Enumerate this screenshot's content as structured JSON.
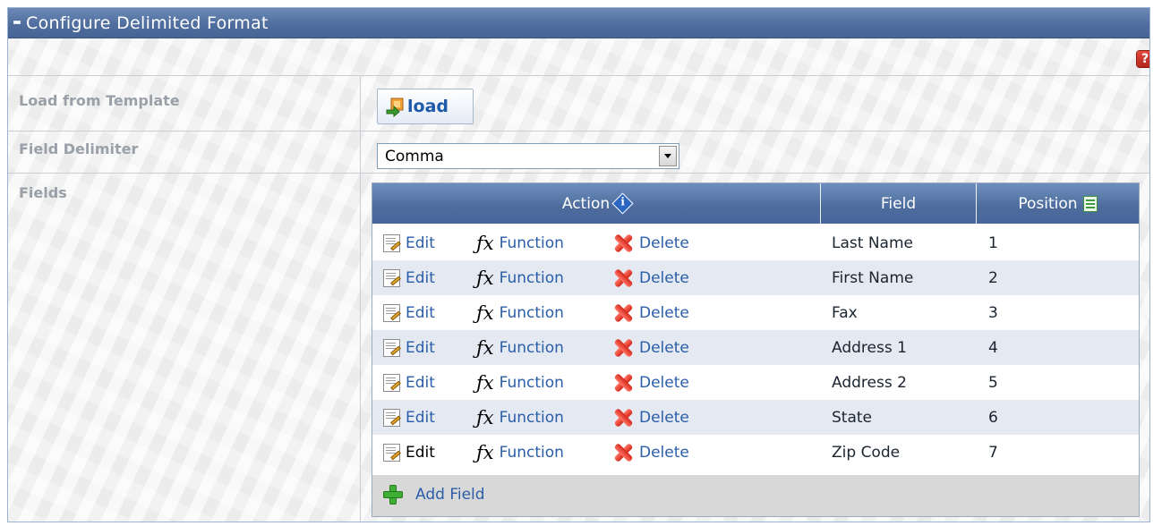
{
  "panel": {
    "title": "Configure Delimited Format",
    "help_symbol": "?"
  },
  "form": {
    "load_template_label": "Load from Template",
    "load_button_label": "load",
    "field_delimiter_label": "Field Delimiter",
    "field_delimiter_value": "Comma",
    "fields_label": "Fields"
  },
  "grid": {
    "columns": {
      "action": "Action",
      "field": "Field",
      "position": "Position"
    },
    "row_actions": {
      "edit": "Edit",
      "function": "Function",
      "delete": "Delete"
    },
    "rows": [
      {
        "field": "Last Name",
        "position": "1"
      },
      {
        "field": "First Name",
        "position": "2"
      },
      {
        "field": "Fax",
        "position": "3"
      },
      {
        "field": "Address 1",
        "position": "4"
      },
      {
        "field": "Address 2",
        "position": "5"
      },
      {
        "field": "State",
        "position": "6"
      },
      {
        "field": "Zip Code",
        "position": "7"
      }
    ],
    "add_field_label": "Add Field"
  },
  "colors": {
    "header_blue": "#4f6e9e",
    "link_blue": "#2a5ea8",
    "row_alt": "#e4e9f2"
  }
}
